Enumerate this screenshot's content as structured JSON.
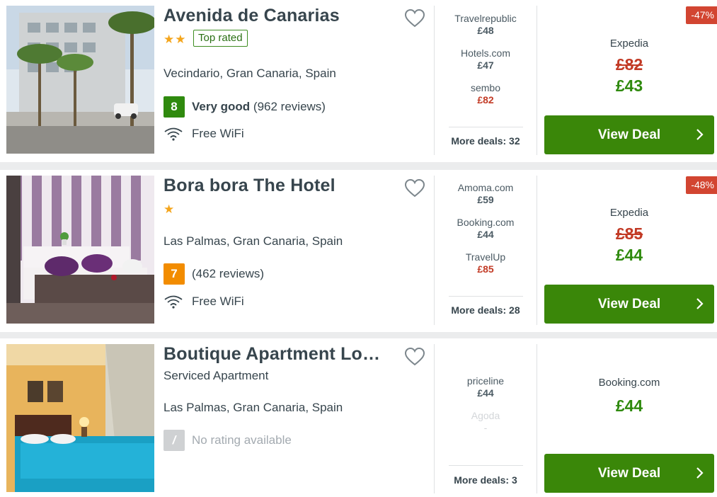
{
  "hotels": [
    {
      "name": "Avenida de Canarias",
      "star_count": 2,
      "stars": "★★",
      "top_rated_label": "Top rated",
      "location": "Vecindario, Gran Canaria, Spain",
      "rating_score": "8",
      "rating_label": "Very good",
      "rating_reviews": "(962 reviews)",
      "amenity": "Free WiFi",
      "deals": [
        {
          "provider": "Travelrepublic",
          "price": "£48"
        },
        {
          "provider": "Hotels.com",
          "price": "£47"
        },
        {
          "provider": "sembo",
          "price": "£82"
        }
      ],
      "more_deals": "More deals: 32",
      "discount": "-47%",
      "main_provider": "Expedia",
      "old_price": "£82",
      "new_price": "£43",
      "button_label": "View Deal"
    },
    {
      "name": "Bora bora The Hotel",
      "star_count": 1,
      "stars": "★",
      "location": "Las Palmas, Gran Canaria, Spain",
      "rating_score": "7",
      "rating_reviews": "(462 reviews)",
      "amenity": "Free WiFi",
      "deals": [
        {
          "provider": "Amoma.com",
          "price": "£59"
        },
        {
          "provider": "Booking.com",
          "price": "£44"
        },
        {
          "provider": "TravelUp",
          "price": "£85"
        }
      ],
      "more_deals": "More deals: 28",
      "discount": "-48%",
      "main_provider": "Expedia",
      "old_price": "£85",
      "new_price": "£44",
      "button_label": "View Deal"
    },
    {
      "name": "Boutique Apartment Lov…",
      "type": "Serviced Apartment",
      "location": "Las Palmas, Gran Canaria, Spain",
      "rating_score": "/",
      "rating_text": "No rating available",
      "deals": [
        {
          "provider": "priceline",
          "price": "£44"
        },
        {
          "provider": "Agoda",
          "price": "-"
        }
      ],
      "more_deals": "More deals: 3",
      "main_provider": "Booking.com",
      "new_price": "£44",
      "button_label": "View Deal"
    }
  ],
  "colors": {
    "score_good": "#2f8a0e",
    "score_ok": "#f28c00",
    "deal_button": "#3a8709",
    "discount_badge": "#d24531",
    "old_price": "#c23a25",
    "new_price": "#2f8a0e",
    "star": "#f4a51c"
  },
  "icons": {
    "favorite": "heart-outline-icon",
    "wifi": "wifi-icon",
    "button_arrow": "chevron-right-icon"
  }
}
